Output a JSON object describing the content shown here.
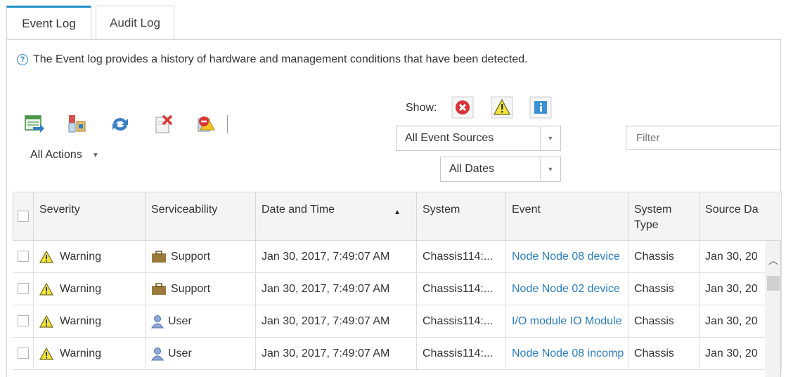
{
  "tabs": [
    {
      "label": "Event Log",
      "active": true
    },
    {
      "label": "Audit Log",
      "active": false
    }
  ],
  "info_text": "The Event log provides a history of hardware and management conditions that have been detected.",
  "toolbar": {
    "icons": [
      "export-icon",
      "filter-chassis-icon",
      "refresh-icon",
      "delete-icon",
      "exclude-icon"
    ],
    "actions_label": "All Actions"
  },
  "show": {
    "label": "Show:",
    "filters": [
      "critical",
      "warning",
      "informational"
    ]
  },
  "source_select": {
    "value": "All Event Sources"
  },
  "date_select": {
    "value": "All Dates"
  },
  "filter_input": {
    "placeholder": "Filter"
  },
  "table": {
    "headers": [
      "Severity",
      "Serviceability",
      "Date and Time",
      "System",
      "Event",
      "System Type",
      "Source Da"
    ],
    "sort_column": "Date and Time",
    "sort_direction": "ascending",
    "rows": [
      {
        "severity": "Warning",
        "serviceability": "Support",
        "svc_icon": "briefcase-icon",
        "datetime": "Jan 30, 2017, 7:49:07 AM",
        "system": "Chassis114:...",
        "event": "Node Node 08 device",
        "system_type": "Chassis",
        "source_date": "Jan 30, 20"
      },
      {
        "severity": "Warning",
        "serviceability": "Support",
        "svc_icon": "briefcase-icon",
        "datetime": "Jan 30, 2017, 7:49:07 AM",
        "system": "Chassis114:...",
        "event": "Node Node 02 device",
        "system_type": "Chassis",
        "source_date": "Jan 30, 20"
      },
      {
        "severity": "Warning",
        "serviceability": "User",
        "svc_icon": "user-icon",
        "datetime": "Jan 30, 2017, 7:49:07 AM",
        "system": "Chassis114:...",
        "event": "I/O module IO Module",
        "system_type": "Chassis",
        "source_date": "Jan 30, 20"
      },
      {
        "severity": "Warning",
        "serviceability": "User",
        "svc_icon": "user-icon",
        "datetime": "Jan 30, 2017, 7:49:07 AM",
        "system": "Chassis114:...",
        "event": "Node Node 08 incomp",
        "system_type": "Chassis",
        "source_date": "Jan 30, 20"
      }
    ]
  },
  "colors": {
    "accent": "#1f8fc9",
    "link": "#2a7dc2",
    "critical": "#d9343a",
    "warning": "#f2d200",
    "info": "#3a92d6"
  }
}
